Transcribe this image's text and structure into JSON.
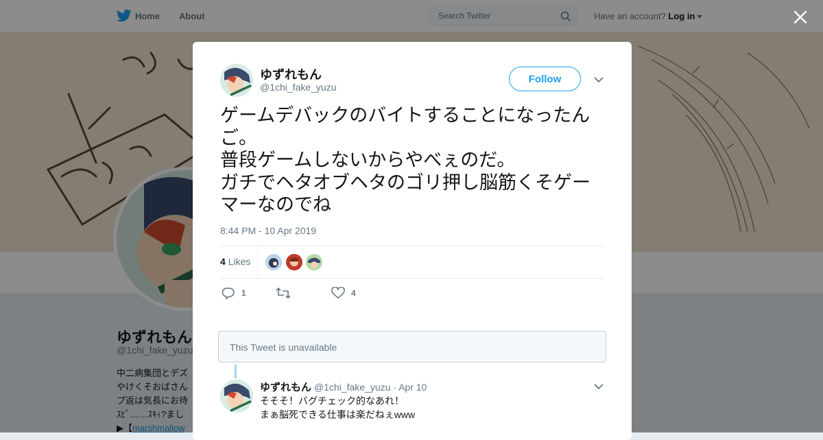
{
  "nav": {
    "home_label": "Home",
    "about_label": "About",
    "search_placeholder": "Search Twitter",
    "account_prompt": "Have an account?",
    "login_label": "Log in"
  },
  "background_profile": {
    "name": "ゆずれもん",
    "handle": "@1chi_fake_yuzu",
    "bio_lines": [
      "中二病集団とデズ",
      "やけくそおばさん",
      "プ返は気長にお待",
      "ｽﾋﾟ……ｽｷｨ?まし",
      "▶【"
    ],
    "bio_link": "marshmallow"
  },
  "tweet": {
    "author_name": "ゆずれもん",
    "author_handle": "@1chi_fake_yuzu",
    "follow_label": "Follow",
    "text": "ゲームデバックのバイトすることになったんご。\n普段ゲームしないからやべぇのだ。\nガチでヘタオブヘタのゴリ押し脳筋くそゲーマーなのでね",
    "timestamp": "8:44 PM - 10 Apr 2019",
    "likes_count": "4",
    "likes_label": "Likes",
    "reply_count": "1",
    "retweet_count": "",
    "like_count": "4"
  },
  "unavailable_notice": "This Tweet is unavailable",
  "reply": {
    "author_name": "ゆずれもん",
    "author_handle": "@1chi_fake_yuzu",
    "date": "· Apr 10",
    "text": "そそそ！バグチェック的なあれ！\nまぁ脳死できる仕事は楽だねぇwww"
  },
  "colors": {
    "brand": "#1da1f2",
    "overlay": "rgba(0,0,0,0.45)",
    "muted_text": "#657786"
  },
  "icons": [
    "twitter-bird-icon",
    "search-icon",
    "close-icon",
    "chevron-down-icon",
    "reply-icon",
    "retweet-icon",
    "heart-icon"
  ]
}
